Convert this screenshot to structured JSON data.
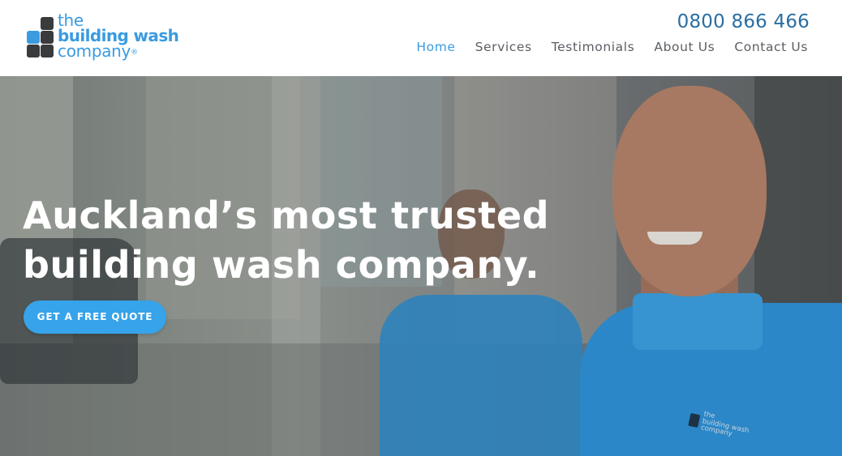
{
  "brand": {
    "line1": "the",
    "line2": "building wash",
    "line3": "company",
    "registered": "®",
    "colors": {
      "primary_blue": "#3a9be0",
      "dark_square": "#3a3b3d",
      "phone_blue": "#2a6ea3"
    }
  },
  "header": {
    "phone": "0800 866 466",
    "nav": [
      {
        "label": "Home",
        "active": true
      },
      {
        "label": "Services",
        "active": false
      },
      {
        "label": "Testimonials",
        "active": false
      },
      {
        "label": "About Us",
        "active": false
      },
      {
        "label": "Contact Us",
        "active": false
      }
    ]
  },
  "hero": {
    "headline_line1": "Auckland’s most trusted",
    "headline_line2": "building wash company.",
    "cta_label": "GET A FREE QUOTE",
    "shirt_logo_lines": [
      "the",
      "building wash",
      "company"
    ],
    "cta_color": "#36a3ea"
  }
}
